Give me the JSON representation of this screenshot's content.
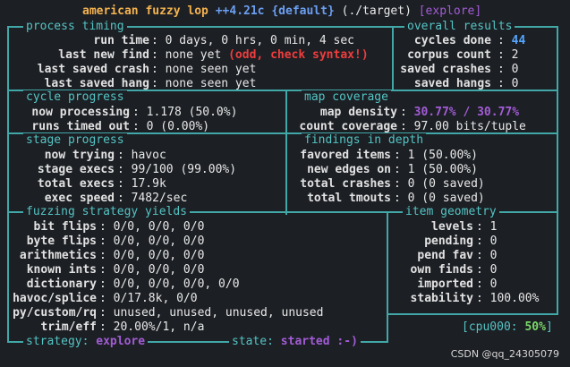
{
  "header": {
    "app_name": "american fuzzy lop",
    "version": "++4.21c",
    "power_schedule": "{default}",
    "target": "(./target)",
    "mode": "[explore]"
  },
  "process_timing": {
    "title": "process timing",
    "rows": [
      {
        "label": "run time",
        "value": "0 days, 0 hrs, 0 min, 4 sec",
        "note": ""
      },
      {
        "label": "last new find",
        "value": "none yet",
        "note": "(odd, check syntax!)"
      },
      {
        "label": "last saved crash",
        "value": "none seen yet",
        "note": ""
      },
      {
        "label": "last saved hang",
        "value": "none seen yet",
        "note": ""
      }
    ]
  },
  "overall_results": {
    "title": "overall results",
    "rows": [
      {
        "label": "cycles done",
        "value": "44"
      },
      {
        "label": "corpus count",
        "value": "2"
      },
      {
        "label": "saved crashes",
        "value": "0"
      },
      {
        "label": "saved hangs",
        "value": "0"
      }
    ]
  },
  "cycle_progress": {
    "title": "cycle progress",
    "rows": [
      {
        "label": "now processing",
        "value": "1.178 (50.0%)"
      },
      {
        "label": "runs timed out",
        "value": "0 (0.00%)"
      }
    ]
  },
  "map_coverage": {
    "title": "map coverage",
    "rows": [
      {
        "label": "map density",
        "value": "30.77% / 30.77%"
      },
      {
        "label": "count coverage",
        "value": "97.00 bits/tuple"
      }
    ]
  },
  "stage_progress": {
    "title": "stage progress",
    "rows": [
      {
        "label": "now trying",
        "value": "havoc"
      },
      {
        "label": "stage execs",
        "value": "99/100 (99.00%)"
      },
      {
        "label": "total execs",
        "value": "17.9k"
      },
      {
        "label": "exec speed",
        "value": "7482/sec"
      }
    ]
  },
  "findings_in_depth": {
    "title": "findings in depth",
    "rows": [
      {
        "label": "favored items",
        "value": "1 (50.00%)"
      },
      {
        "label": "new edges on",
        "value": "1 (50.00%)"
      },
      {
        "label": "total crashes",
        "value": "0 (0 saved)"
      },
      {
        "label": "total tmouts",
        "value": "0 (0 saved)"
      }
    ]
  },
  "strategy_yields": {
    "title": "fuzzing strategy yields",
    "rows": [
      {
        "label": "bit flips",
        "value": "0/0, 0/0, 0/0"
      },
      {
        "label": "byte flips",
        "value": "0/0, 0/0, 0/0"
      },
      {
        "label": "arithmetics",
        "value": "0/0, 0/0, 0/0"
      },
      {
        "label": "known ints",
        "value": "0/0, 0/0, 0/0"
      },
      {
        "label": "dictionary",
        "value": "0/0, 0/0, 0/0, 0/0"
      },
      {
        "label": "havoc/splice",
        "value": "0/17.8k, 0/0"
      },
      {
        "label": "py/custom/rq",
        "value": "unused, unused, unused, unused"
      },
      {
        "label": "trim/eff",
        "value": "20.00%/1, n/a"
      }
    ]
  },
  "item_geometry": {
    "title": "item geometry",
    "rows": [
      {
        "label": "levels",
        "value": "1"
      },
      {
        "label": "pending",
        "value": "0"
      },
      {
        "label": "pend fav",
        "value": "0"
      },
      {
        "label": "own finds",
        "value": "0"
      },
      {
        "label": "imported",
        "value": "0"
      },
      {
        "label": "stability",
        "value": "100.00%"
      }
    ]
  },
  "cpu": {
    "label": "cpu000:",
    "value": "50%"
  },
  "footer": {
    "strategy_label": "strategy:",
    "strategy_value": "explore",
    "state_label": "state:",
    "state_value": "started :-)"
  },
  "watermark": "CSDN @qq_24305079",
  "colors": {
    "background": "#1c1f24",
    "border": "#41a7a7",
    "title": "#54c4c4",
    "header": "#f5b34f",
    "accent_blue": "#6b9ff2",
    "accent_purple": "#a35cd6",
    "warning_red": "#ef3d3d"
  }
}
